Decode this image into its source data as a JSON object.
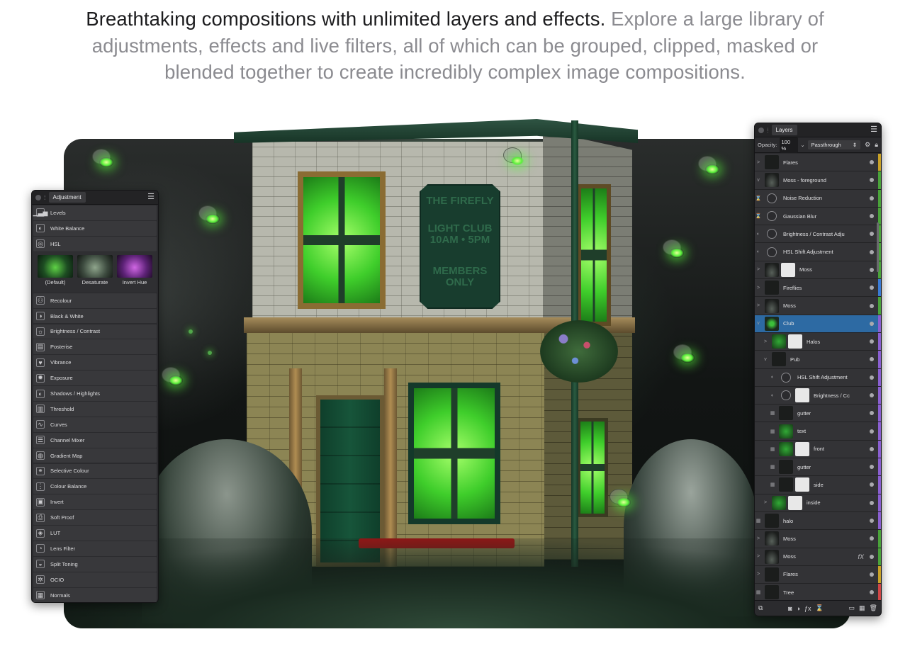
{
  "headline": {
    "lead": "Breathtaking compositions with unlimited layers and effects.",
    "rest": "Explore a large library of adjustments, effects and live filters, all of which can be grouped, clipped, masked or blended together to create incredibly complex image compositions."
  },
  "scene": {
    "sign": {
      "line1": "THE FIREFLY",
      "line2": "LIGHT CLUB 10AM • 5PM",
      "line3": "MEMBERS ONLY"
    }
  },
  "adjustment_panel": {
    "tab": "Adjustment",
    "items_top": [
      {
        "label": "Levels",
        "icon": "levels-icon",
        "glyph": "▁▃▅"
      },
      {
        "label": "White Balance",
        "icon": "white-balance-icon",
        "glyph": "◐"
      },
      {
        "label": "HSL",
        "icon": "hsl-icon",
        "glyph": "◎"
      }
    ],
    "presets": [
      {
        "label": "(Default)"
      },
      {
        "label": "Desaturate"
      },
      {
        "label": "Invert Hue"
      }
    ],
    "items": [
      {
        "label": "Recolour",
        "icon": "recolour-icon",
        "glyph": "⚇"
      },
      {
        "label": "Black & White",
        "icon": "black-white-icon",
        "glyph": "◑"
      },
      {
        "label": "Brightness / Contrast",
        "icon": "brightness-contrast-icon",
        "glyph": "☼"
      },
      {
        "label": "Posterise",
        "icon": "posterise-icon",
        "glyph": "▤"
      },
      {
        "label": "Vibrance",
        "icon": "vibrance-icon",
        "glyph": "♥"
      },
      {
        "label": "Exposure",
        "icon": "exposure-icon",
        "glyph": "✹"
      },
      {
        "label": "Shadows / Highlights",
        "icon": "shadows-highlights-icon",
        "glyph": "◐"
      },
      {
        "label": "Threshold",
        "icon": "threshold-icon",
        "glyph": "▥"
      },
      {
        "label": "Curves",
        "icon": "curves-icon",
        "glyph": "∿"
      },
      {
        "label": "Channel Mixer",
        "icon": "channel-mixer-icon",
        "glyph": "☰"
      },
      {
        "label": "Gradient Map",
        "icon": "gradient-map-icon",
        "glyph": "◍"
      },
      {
        "label": "Selective Colour",
        "icon": "selective-colour-icon",
        "glyph": "⚭"
      },
      {
        "label": "Colour Balance",
        "icon": "colour-balance-icon",
        "glyph": "⋮"
      },
      {
        "label": "Invert",
        "icon": "invert-icon",
        "glyph": "▣"
      },
      {
        "label": "Soft Proof",
        "icon": "soft-proof-icon",
        "glyph": "⎙"
      },
      {
        "label": "LUT",
        "icon": "lut-icon",
        "glyph": "◈"
      },
      {
        "label": "Lens Filter",
        "icon": "lens-filter-icon",
        "glyph": "◔"
      },
      {
        "label": "Split Toning",
        "icon": "split-toning-icon",
        "glyph": "◒"
      },
      {
        "label": "OCIO",
        "icon": "ocio-icon",
        "glyph": "✲"
      },
      {
        "label": "Normals",
        "icon": "normals-icon",
        "glyph": "▦"
      }
    ]
  },
  "layers_panel": {
    "tab": "Layers",
    "opacity_label": "Opacity:",
    "opacity_value": "100 %",
    "blend_mode": "Passthrough",
    "layers": [
      {
        "name": "Flares",
        "lead": ">",
        "thumb": "dark",
        "tag": "#c9a227",
        "indent": 0
      },
      {
        "name": "Moss - foreground",
        "lead": "v",
        "thumb": "moss",
        "tag": "#4aa33a",
        "indent": 0
      },
      {
        "name": "Noise Reduction",
        "lead": "⌛",
        "thumb": "adj",
        "tag": "#4aa33a",
        "indent": 0
      },
      {
        "name": "Gaussian Blur",
        "lead": "⌛",
        "thumb": "adj",
        "tag": "#4aa33a",
        "indent": 0
      },
      {
        "name": "Brightness / Contrast Adju",
        "lead": "◐",
        "thumb": "adj",
        "tag": "#4aa33a",
        "indent": 0
      },
      {
        "name": "HSL Shift Adjustment",
        "lead": "◐",
        "thumb": "adj",
        "tag": "#4aa33a",
        "indent": 0
      },
      {
        "name": "Moss",
        "lead": ">",
        "thumb": "moss",
        "mask": true,
        "tag": "#4aa33a",
        "indent": 0
      },
      {
        "name": "Fireflies",
        "lead": ">",
        "thumb": "dark",
        "tag": "#3a7bd5",
        "indent": 0
      },
      {
        "name": "Moss",
        "lead": ">",
        "thumb": "moss",
        "tag": "#4aa33a",
        "indent": 0
      },
      {
        "name": "Club",
        "lead": "v",
        "thumb": "club",
        "tag": "#8a5fd1",
        "indent": 0,
        "selected": true
      },
      {
        "name": "Halos",
        "lead": ">",
        "thumb": "green",
        "mask": true,
        "tag": "#8a5fd1",
        "indent": 1
      },
      {
        "name": "Pub",
        "lead": "v",
        "thumb": "dark",
        "tag": "#8a5fd1",
        "indent": 1
      },
      {
        "name": "HSL Shift Adjustment",
        "lead": "◐",
        "thumb": "adj",
        "tag": "#8a5fd1",
        "indent": 2
      },
      {
        "name": "Brightness / Cc",
        "lead": "◐",
        "thumb": "adj",
        "mask": true,
        "tag": "#8a5fd1",
        "indent": 2
      },
      {
        "name": "gutter",
        "lead": "▦",
        "thumb": "dark",
        "tag": "#8a5fd1",
        "indent": 2
      },
      {
        "name": "text",
        "lead": "▦",
        "thumb": "green",
        "tag": "#8a5fd1",
        "indent": 2
      },
      {
        "name": "front",
        "lead": "▦",
        "thumb": "green",
        "mask": true,
        "tag": "#8a5fd1",
        "indent": 2
      },
      {
        "name": "gutter",
        "lead": "▦",
        "thumb": "dark",
        "tag": "#8a5fd1",
        "indent": 2
      },
      {
        "name": "side",
        "lead": "▦",
        "thumb": "dark",
        "mask": true,
        "tag": "#8a5fd1",
        "indent": 2
      },
      {
        "name": "inside",
        "lead": ">",
        "thumb": "green",
        "mask": true,
        "tag": "#8a5fd1",
        "indent": 1
      },
      {
        "name": "halo",
        "lead": "▦",
        "thumb": "dark",
        "tag": "#8a5fd1",
        "indent": 0
      },
      {
        "name": "Moss",
        "lead": ">",
        "thumb": "moss",
        "tag": "#4aa33a",
        "indent": 0
      },
      {
        "name": "Moss",
        "lead": ">",
        "thumb": "moss",
        "tag": "#4aa33a",
        "indent": 0,
        "fx": "fX"
      },
      {
        "name": "Flares",
        "lead": ">",
        "thumb": "dark",
        "tag": "#c9a227",
        "indent": 0
      },
      {
        "name": "Tree",
        "lead": "▦",
        "thumb": "dark",
        "tag": "#d04646",
        "indent": 0
      }
    ],
    "footer_icons": [
      "copy-icon",
      "mask-icon",
      "adjustment-icon",
      "fx-icon",
      "live-filter-icon",
      "group-icon",
      "pixel-layer-icon",
      "trash-icon"
    ]
  }
}
